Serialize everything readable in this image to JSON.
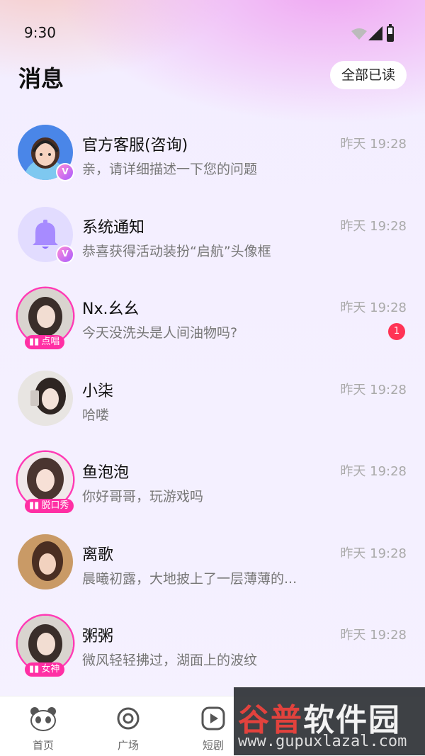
{
  "status_bar": {
    "time": "9:30"
  },
  "header": {
    "title": "消息",
    "mark_all_read": "全部已读"
  },
  "conversations": [
    {
      "name": "官方客服(咨询)",
      "preview": "亲，请详细描述一下您的问题",
      "time": "昨天 19:28",
      "badge": "V"
    },
    {
      "name": "系统通知",
      "preview": "恭喜获得活动装扮“启航”头像框",
      "time": "昨天 19:28",
      "badge": "V"
    },
    {
      "name": "Nx.幺幺",
      "preview": "今天没洗头是人间油物吗?",
      "time": "昨天 19:28",
      "tag": "点唱",
      "unread": "1"
    },
    {
      "name": "小柒",
      "preview": "哈喽",
      "time": "昨天 19:28"
    },
    {
      "name": "鱼泡泡",
      "preview": "你好哥哥，玩游戏吗",
      "time": "昨天 19:28",
      "tag": "脱口秀"
    },
    {
      "name": "离歌",
      "preview": "晨曦初露，大地披上了一层薄薄的...",
      "time": "昨天 19:28"
    },
    {
      "name": "粥粥",
      "preview": "微风轻轻拂过，湖面上的波纹",
      "time": "昨天 19:28",
      "tag": "女神"
    }
  ],
  "tabs": [
    {
      "label": "首页",
      "icon": "panda-icon"
    },
    {
      "label": "广场",
      "icon": "plaza-icon"
    },
    {
      "label": "短剧",
      "icon": "play-icon"
    }
  ],
  "watermark": {
    "title_a": "谷普",
    "title_b": "软件园",
    "url": "www.gupuxlazal.com"
  },
  "colors": {
    "accent": "#ff2fa4",
    "unread": "#ff3355",
    "bell": "#a78bff"
  }
}
